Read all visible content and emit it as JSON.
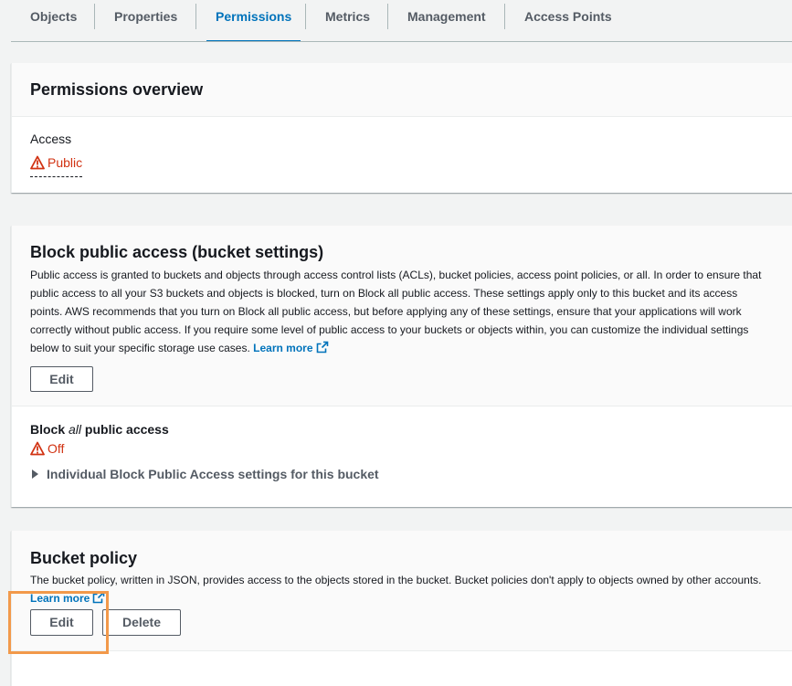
{
  "tabs": [
    {
      "label": "Objects"
    },
    {
      "label": "Properties"
    },
    {
      "label": "Permissions",
      "active": true
    },
    {
      "label": "Metrics"
    },
    {
      "label": "Management"
    },
    {
      "label": "Access Points"
    }
  ],
  "overview": {
    "title": "Permissions overview",
    "access_label": "Access",
    "access_value": "Public"
  },
  "block_public": {
    "title": "Block public access (bucket settings)",
    "description": "Public access is granted to buckets and objects through access control lists (ACLs), bucket policies, access point policies, or all. In order to ensure that public access to all your S3 buckets and objects is blocked, turn on Block all public access. These settings apply only to this bucket and its access points. AWS recommends that you turn on Block all public access, but before applying any of these settings, ensure that your applications will work correctly without public access. If you require some level of public access to your buckets or objects within, you can customize the individual settings below to suit your specific storage use cases.",
    "learn_more": "Learn more",
    "edit_label": "Edit",
    "setting_prefix": "Block ",
    "setting_emphasis": "all",
    "setting_suffix": " public access",
    "setting_value": "Off",
    "expander_label": "Individual Block Public Access settings for this bucket"
  },
  "bucket_policy": {
    "title": "Bucket policy",
    "description": "The bucket policy, written in JSON, provides access to the objects stored in the bucket. Bucket policies don't apply to objects owned by other accounts.",
    "learn_more": "Learn more",
    "edit_label": "Edit",
    "delete_label": "Delete"
  },
  "colors": {
    "accent": "#0073bb",
    "warning": "#d13212",
    "highlight": "#f2994a"
  }
}
